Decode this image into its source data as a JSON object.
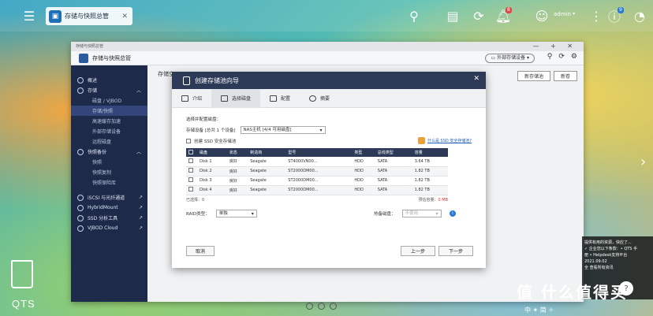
{
  "topbar": {
    "task_title": "存储与快照总管",
    "user": "admin",
    "notification_count": "8",
    "info_count": "9"
  },
  "window": {
    "small_title": "存储与快照总管",
    "title": "存储与快照总管",
    "external_device_label": "外部存储设备",
    "content_peek": "存储空",
    "right_buttons": [
      "新存储池",
      "新卷"
    ]
  },
  "sidebar": {
    "items": [
      {
        "label": "概述",
        "type": "top"
      },
      {
        "label": "存储",
        "type": "top"
      },
      {
        "label": "磁盘 / VJBOD",
        "type": "sub"
      },
      {
        "label": "存储/快照",
        "type": "sub"
      },
      {
        "label": "高速缓存加速",
        "type": "sub"
      },
      {
        "label": "外部存储设备",
        "type": "sub"
      },
      {
        "label": "远程磁盘",
        "type": "sub"
      },
      {
        "label": "快照备份",
        "type": "top"
      },
      {
        "label": "快照",
        "type": "sub"
      },
      {
        "label": "快照复制",
        "type": "sub"
      },
      {
        "label": "快照保险库",
        "type": "sub"
      },
      {
        "label": "iSCSI 与光纤通道",
        "type": "top"
      },
      {
        "label": "HybridMount",
        "type": "top"
      },
      {
        "label": "SSD 分析工具",
        "type": "top"
      },
      {
        "label": "VJBOD Cloud",
        "type": "top"
      }
    ]
  },
  "modal": {
    "title": "创建存储池向导",
    "steps": [
      "介绍",
      "选择磁盘",
      "配置",
      "摘要"
    ],
    "section_label": "选择并配置磁盘：",
    "enclosure_label": "存储设备 [总共 1 个设备]",
    "enclosure_value": "NAS主机 [4/4 可用磁盘]",
    "ssd_profile_label": "创建 SSD 安全存储池",
    "link_label": "什么是 SSD 安全存储池?",
    "table": {
      "headers": [
        "磁盘",
        "状态",
        "制造商",
        "型号",
        "类型",
        "总线类型",
        "容量"
      ],
      "rows": [
        [
          "Disk 1",
          "良好",
          "Seagate",
          "ST4000VN00...",
          "HDD",
          "SATA",
          "3.64 TB"
        ],
        [
          "Disk 2",
          "良好",
          "Seagate",
          "ST2000DM00...",
          "HDD",
          "SATA",
          "1.82 TB"
        ],
        [
          "Disk 3",
          "良好",
          "Seagate",
          "ST2000DM00...",
          "HDD",
          "SATA",
          "1.82 TB"
        ],
        [
          "Disk 4",
          "良好",
          "Seagate",
          "ST2000DM00...",
          "HDD",
          "SATA",
          "1.82 TB"
        ]
      ]
    },
    "selected_label": "已选择：0",
    "capacity_label": "预估容量：",
    "capacity_value": "0 MB",
    "raid_label": "RAID类型：",
    "raid_value": "单独",
    "hot_spare_label": "热备磁盘：",
    "hot_spare_value": "不使用",
    "cancel": "取消",
    "prev": "上一步",
    "next": "下一步"
  },
  "desktop": {
    "brand": "QTS",
    "notification_lines": [
      "提供有用的资源，快应了...",
      "✓ 企业您以下条款：• QTS 手",
      "册 • Helpdesk支持平台",
      "2021.09.02",
      "全 查看所有资讯"
    ],
    "watermark_logo": "值 什么值得买",
    "watermark_sub": "中 ✦ 简 ✧"
  }
}
